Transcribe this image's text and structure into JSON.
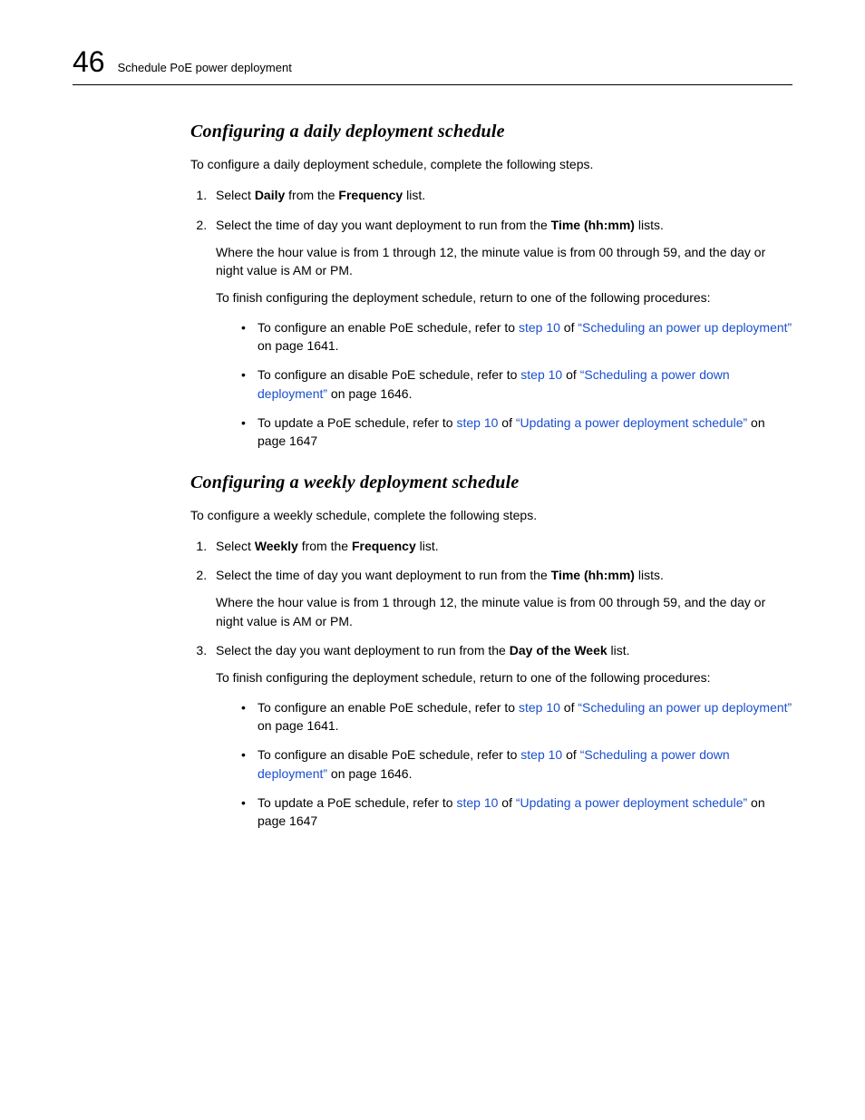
{
  "header": {
    "chapter_number": "46",
    "chapter_title": "Schedule PoE power deployment"
  },
  "section1": {
    "heading": "Configuring a daily deployment schedule",
    "intro": "To configure a daily deployment schedule, complete the following steps.",
    "step1_pre": "Select ",
    "step1_b1": "Daily",
    "step1_mid": " from the ",
    "step1_b2": "Frequency",
    "step1_post": " list.",
    "step2_pre": "Select the time of day you want deployment to run from the ",
    "step2_b1": "Time (hh:mm)",
    "step2_post": " lists.",
    "step2_sub1": "Where the hour value is from 1 through 12, the minute value is from 00 through 59, and the day or night value is AM or PM.",
    "step2_sub2": "To finish configuring the deployment schedule, return to one of the following procedures:",
    "b1_pre": "To configure an enable PoE schedule, refer to ",
    "b1_link1": "step 10",
    "b1_mid": " of ",
    "b1_link2": "“Scheduling an power up deployment”",
    "b1_post": " on page 1641.",
    "b2_pre": "To configure an disable PoE schedule, refer to ",
    "b2_link1": "step 10",
    "b2_mid": " of ",
    "b2_link2": "“Scheduling a power down deployment”",
    "b2_post": " on page 1646.",
    "b3_pre": "To update a PoE schedule, refer to ",
    "b3_link1": "step 10",
    "b3_mid": " of ",
    "b3_link2": "“Updating a power deployment schedule”",
    "b3_post": " on page 1647"
  },
  "section2": {
    "heading": "Configuring a weekly deployment schedule",
    "intro": "To configure a weekly schedule, complete the following steps.",
    "step1_pre": "Select ",
    "step1_b1": "Weekly",
    "step1_mid": " from the ",
    "step1_b2": "Frequency",
    "step1_post": " list.",
    "step2_pre": "Select the time of day you want deployment to run from the ",
    "step2_b1": "Time (hh:mm)",
    "step2_post": " lists.",
    "step2_sub1": "Where the hour value is from 1 through 12, the minute value is from 00 through 59, and the day or night value is AM or PM.",
    "step3_pre": "Select the day you want deployment to run from the ",
    "step3_b1": "Day of the Week",
    "step3_post": " list.",
    "step3_sub1": "To finish configuring the deployment schedule, return to one of the following procedures:",
    "b1_pre": "To configure an enable PoE schedule, refer to ",
    "b1_link1": "step 10",
    "b1_mid": " of ",
    "b1_link2": "“Scheduling an power up deployment”",
    "b1_post": " on page 1641.",
    "b2_pre": "To configure an disable PoE schedule, refer to ",
    "b2_link1": "step 10",
    "b2_mid": " of ",
    "b2_link2": "“Scheduling a power down deployment”",
    "b2_post": " on page 1646.",
    "b3_pre": "To update a PoE schedule, refer to ",
    "b3_link1": "step 10",
    "b3_mid": " of ",
    "b3_link2": "“Updating a power deployment schedule”",
    "b3_post": " on page 1647"
  }
}
